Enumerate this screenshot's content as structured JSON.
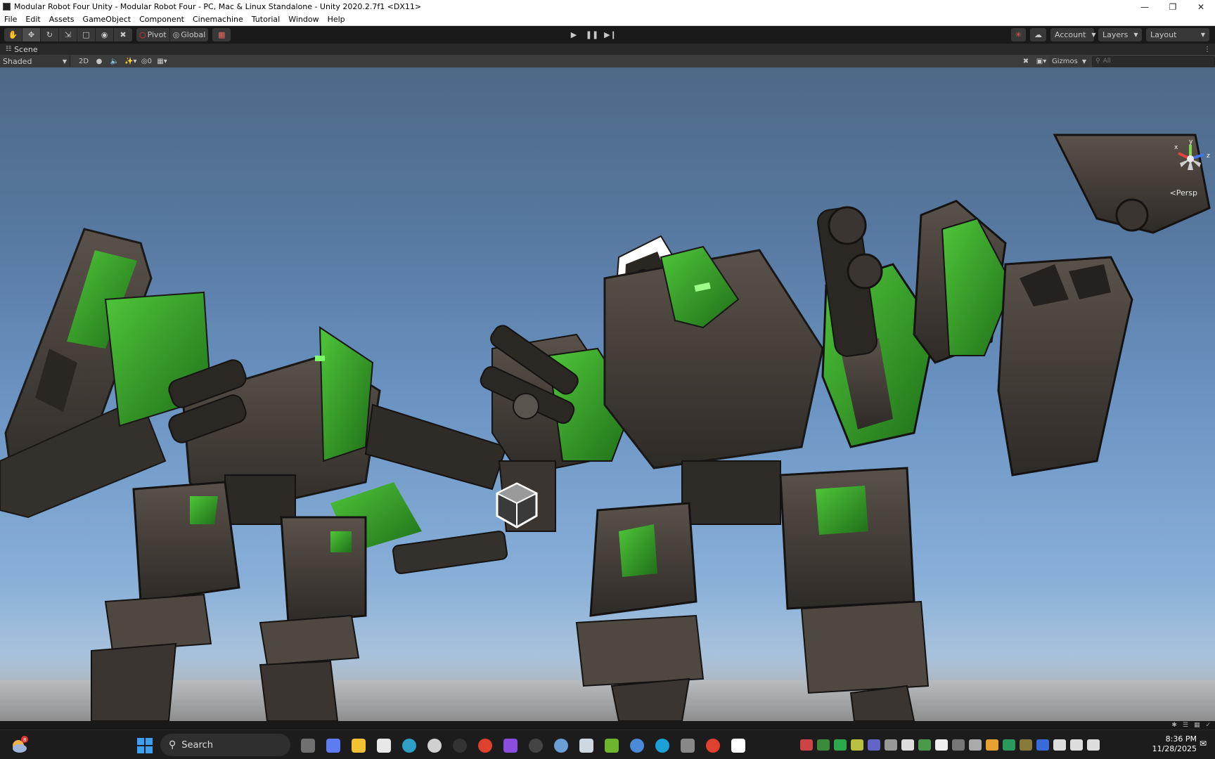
{
  "window": {
    "title": "Modular Robot Four Unity - Modular Robot Four - PC, Mac & Linux Standalone - Unity 2020.2.7f1 <DX11>",
    "controls": [
      "minimize-icon",
      "restore-icon",
      "close-icon"
    ]
  },
  "menu": [
    "File",
    "Edit",
    "Assets",
    "GameObject",
    "Component",
    "Cinemachine",
    "Tutorial",
    "Window",
    "Help"
  ],
  "toolbar": {
    "tools": [
      "hand-icon",
      "move-icon",
      "rotate-icon",
      "scale-icon",
      "rect-icon",
      "transform-icon",
      "custom-tool-icon"
    ],
    "pivot_label": "Pivot",
    "global_label": "Global",
    "account_label": "Account",
    "layers_label": "Layers",
    "layout_label": "Layout"
  },
  "scene_tab": {
    "label": "Scene"
  },
  "scene_toolbar": {
    "shading_mode": "Shaded",
    "mode_2d": "2D",
    "hidden_count": "0",
    "gizmos_label": "Gizmos",
    "search_placeholder": "All"
  },
  "scene_view": {
    "projection_label": "Persp",
    "gizmo_axes": {
      "x": "x",
      "y": "y",
      "z": "z"
    }
  },
  "taskbar": {
    "search_label": "Search",
    "weather_badge": "8",
    "time": "8:36 PM",
    "date": "11/28/2025"
  },
  "colors": {
    "accent_green": "#3fbf2f",
    "metal_dark": "#3b3631",
    "metal_mid": "#5a524a",
    "sky_top": "#4d6986",
    "sky_bottom": "#a8c2dc"
  }
}
